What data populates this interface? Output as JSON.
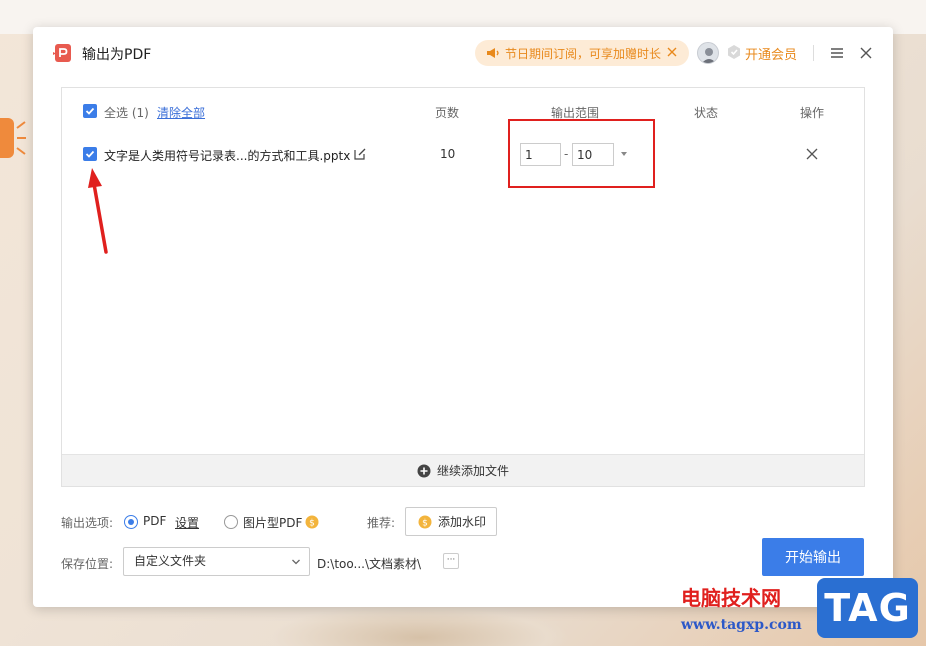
{
  "dialog": {
    "title": "输出为PDF",
    "promo_text": "节日期间订阅，可享加赠时长",
    "vip_label": "开通会员"
  },
  "table": {
    "select_all_label": "全选",
    "select_count": "(1)",
    "clear_all_label": "清除全部",
    "headers": {
      "pages": "页数",
      "range": "输出范围",
      "status": "状态",
      "action": "操作"
    },
    "rows": [
      {
        "file_name": "文字是人类用符号记录表...的方式和工具.pptx",
        "pages": "10",
        "range_from": "1",
        "range_to": "10",
        "status": ""
      }
    ],
    "add_more_label": "继续添加文件"
  },
  "options": {
    "label": "输出选项:",
    "pdf_label": "PDF",
    "settings_label": "设置",
    "image_pdf_label": "图片型PDF",
    "recommend_label": "推荐:",
    "watermark_button": "添加水印"
  },
  "save": {
    "label": "保存位置:",
    "folder_value": "自定义文件夹",
    "path": "D:\\too...\\文档素材\\",
    "more": "···",
    "start_button": "开始输出"
  },
  "watermark": {
    "site": "电脑技术网",
    "url": "www.tagxp.com",
    "tag": "TAG"
  },
  "colors": {
    "accent": "#3b7de8",
    "promo": "#e8891c",
    "annotation": "#e0201e"
  }
}
